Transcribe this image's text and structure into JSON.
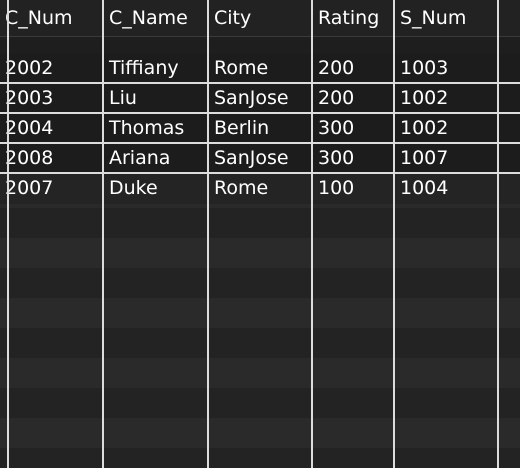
{
  "table": {
    "columns": [
      "C_Num",
      "C_Name",
      "City",
      "Rating",
      "S_Num"
    ],
    "rows": [
      [
        "2002",
        "Tiffiany",
        "Rome",
        "200",
        "1003"
      ],
      [
        "2003",
        "Liu",
        "SanJose",
        "200",
        "1002"
      ],
      [
        "2004",
        "Thomas",
        "Berlin",
        "300",
        "1002"
      ],
      [
        "2008",
        "Ariana",
        "SanJose",
        "300",
        "1007"
      ],
      [
        "2007",
        "Duke",
        "Rome",
        "100",
        "1004"
      ]
    ]
  }
}
